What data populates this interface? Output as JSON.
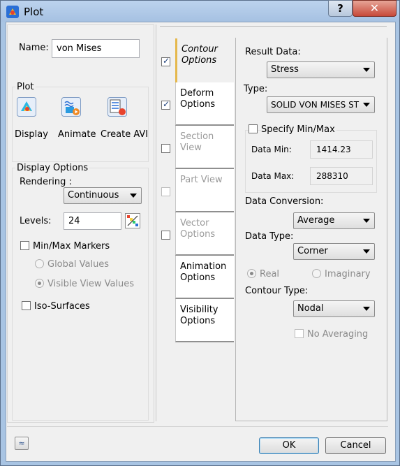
{
  "window": {
    "title": "Plot",
    "help_glyph": "?",
    "close_glyph": "✕"
  },
  "name_field": {
    "label": "Name:",
    "value": "von Mises"
  },
  "plot_group": {
    "title": "Plot",
    "display_label": "Display",
    "animate_label": "Animate",
    "create_avi_label": "Create AVI"
  },
  "display_options": {
    "title": "Display Options",
    "rendering_label": "Rendering :",
    "rendering_value": "Continuous",
    "levels_label": "Levels:",
    "levels_value": "24",
    "minmax_markers_label": "Min/Max Markers",
    "global_values_label": "Global Values",
    "visible_view_values_label": "Visible View Values",
    "iso_surfaces_label": "Iso-Surfaces"
  },
  "tabs": [
    {
      "label": "Contour Options",
      "checked": true
    },
    {
      "label": "Deform Options",
      "checked": true
    },
    {
      "label": "Section View",
      "checked": false
    },
    {
      "label": "Part View",
      "checked": false
    },
    {
      "label": "Vector Options",
      "checked": false
    },
    {
      "label": "Animation Options"
    },
    {
      "label": "Visibility Options"
    }
  ],
  "contour": {
    "result_data_label": "Result Data:",
    "result_data_value": "Stress",
    "type_label": "Type:",
    "type_value": "SOLID VON MISES ST",
    "specify_minmax_label": "Specify Min/Max",
    "data_min_label": "Data Min:",
    "data_min_value": "1414.23",
    "data_max_label": "Data Max:",
    "data_max_value": "288310",
    "data_conversion_label": "Data Conversion:",
    "data_conversion_value": "Average",
    "data_type_label": "Data Type:",
    "data_type_value": "Corner",
    "real_label": "Real",
    "imaginary_label": "Imaginary",
    "contour_type_label": "Contour Type:",
    "contour_type_value": "Nodal",
    "no_averaging_label": "No Averaging"
  },
  "footer": {
    "expand_glyph": "≈",
    "ok_label": "OK",
    "cancel_label": "Cancel"
  }
}
